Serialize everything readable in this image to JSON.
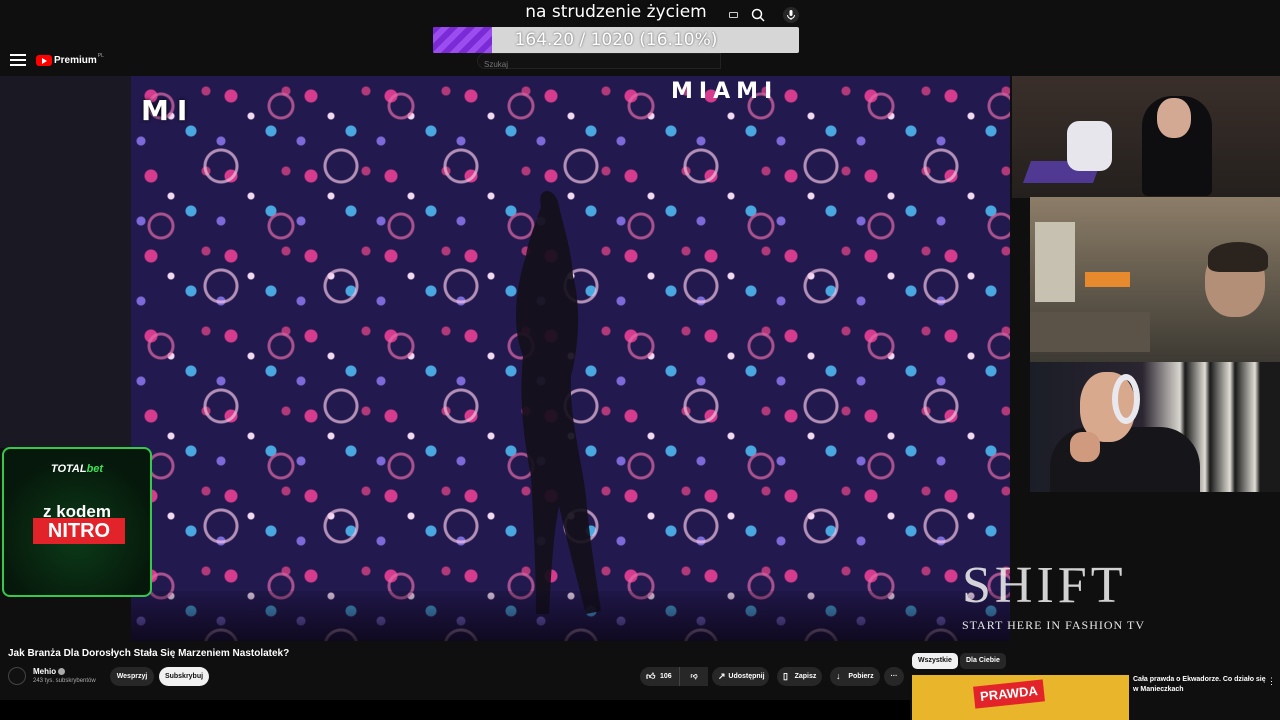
{
  "overlay": {
    "goal_title": "na strudzenie życiem",
    "goal_text": "164.20 / 1020 (16.10%)",
    "goal_progress": 0.161
  },
  "header": {
    "brand": "Premium",
    "country": "PL",
    "search_placeholder": "Szukaj"
  },
  "video": {
    "watermark_logo": "SHIFT",
    "watermark_tagline": "START HERE IN FASHION TV",
    "onscreen_text_left": "MI",
    "onscreen_text_right": "MIAMI"
  },
  "ad": {
    "brand_total": "TOTAL",
    "brand_bet": "bet",
    "line1": "z kodem",
    "code": "NITRO"
  },
  "watch": {
    "title": "Jak Branża Dla Dorosłych Stała Się Marzeniem Nastolatek?",
    "channel_name": "Mehio",
    "subscribers": "243 tys. subskrybentów",
    "support_label": "Wesprzyj",
    "subscribe_label": "Subskrybuj",
    "likes": "106",
    "share_label": "Udostępnij",
    "save_label": "Zapisz",
    "download_label": "Pobierz"
  },
  "sidebar": {
    "chips": [
      "Wszystkie",
      "Dla Ciebie"
    ],
    "rec_title": "Cała prawda o Ekwadorze. Co działo się w Manieczkach",
    "rec_thumb_stamp": "PRAWDA"
  }
}
